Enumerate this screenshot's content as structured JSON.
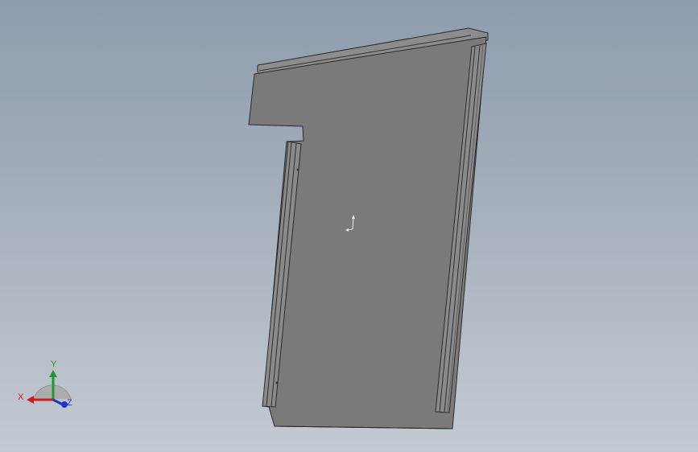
{
  "viewport": {
    "background_top": "#8e9cad",
    "background_bottom": "#c4cad2"
  },
  "part": {
    "face_color": "#7a7a7a",
    "edge_color": "#2a2a2a",
    "flange_color": "#9a9a9a"
  },
  "triad": {
    "x_label": "X",
    "y_label": "Y",
    "z_label": "Z",
    "x_color": "#cc1f1f",
    "y_color": "#1f9a2a",
    "z_color": "#1f35c8"
  }
}
